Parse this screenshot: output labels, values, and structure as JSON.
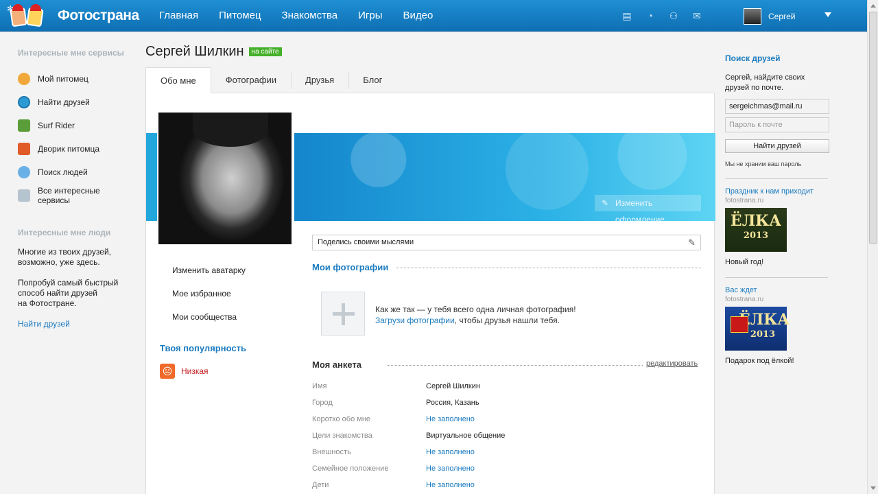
{
  "logo": {
    "text": "Фотострана"
  },
  "nav": [
    "Главная",
    "Питомец",
    "Знакомства",
    "Игры",
    "Видео"
  ],
  "header_icons": [
    "list-icon",
    "pacman-icon",
    "friends-icon",
    "mail-icon"
  ],
  "user": {
    "name": "Сергей"
  },
  "left": {
    "services_title": "Интересные мне сервисы",
    "services": [
      {
        "label": "Мой питомец",
        "icon": "paw-icon"
      },
      {
        "label": "Найти друзей",
        "icon": "find-friends-icon"
      },
      {
        "label": "Surf Rider",
        "icon": "surf-rider-icon"
      },
      {
        "label": "Дворик питомца",
        "icon": "house-icon"
      },
      {
        "label": "Поиск людей",
        "icon": "search-people-icon"
      },
      {
        "label": "Все интересные сервисы",
        "icon": "all-services-icon"
      }
    ],
    "people_title": "Интересные мне люди",
    "people_text1a": "Многие из твоих друзей,",
    "people_text1b": "возможно, уже здесь.",
    "people_text2a": "Попробуй самый быстрый",
    "people_text2b": "способ найти друзей",
    "people_text2c": "на Фотостране.",
    "people_link": "Найти друзей"
  },
  "profile": {
    "name": "Сергей Шилкин",
    "status": "на сайте",
    "tabs": [
      "Обо мне",
      "Фотографии",
      "Друзья",
      "Блог"
    ],
    "cover_button": "Изменить оформление",
    "links": [
      "Изменить аватарку",
      "Мое избранное",
      "Мои сообщества"
    ],
    "popularity_title": "Твоя популярность",
    "popularity_value": "Низкая",
    "share_placeholder": "Поделись своими мыслями",
    "photos_title": "Мои фотографии",
    "photos_msg_line1": "Как же так — у тебя всего одна личная фотография!",
    "photos_msg_link": "Загрузи фотографии",
    "photos_msg_rest": ", чтобы друзья нашли тебя.",
    "anketa_title": "Моя анкета",
    "anketa_edit": "редактировать",
    "anketa": [
      {
        "k": "Имя",
        "v": "Сергей Шилкин",
        "empty": false
      },
      {
        "k": "Город",
        "v": "Россия, Казань",
        "empty": false
      },
      {
        "k": "Коротко обо мне",
        "v": "Не заполнено",
        "empty": true
      },
      {
        "k": "Цели знакомства",
        "v": "Виртуальное общение",
        "empty": false
      },
      {
        "k": "Внешность",
        "v": "Не заполнено",
        "empty": true
      },
      {
        "k": "Семейное положение",
        "v": "Не заполнено",
        "empty": true
      },
      {
        "k": "Дети",
        "v": "Не заполнено",
        "empty": true
      }
    ]
  },
  "right": {
    "title": "Поиск друзей",
    "text1": "Сергей, найдите своих",
    "text2": "друзей по почте.",
    "email_value": "sergeichmas@mail.ru",
    "password_placeholder": "Пароль к почте",
    "button": "Найти друзей",
    "note": "Мы не храним ваш пароль",
    "ads": [
      {
        "title": "Праздник к нам приходит",
        "src": "fotostrana.ru",
        "img_main": "ЁЛКА",
        "img_year": "2013",
        "caption": "Новый год!"
      },
      {
        "title": "Вас ждет",
        "src": "fotostrana.ru",
        "img_main": "ЁЛКА",
        "img_year": "2013",
        "caption": "Подарок под ёлкой!"
      }
    ]
  }
}
